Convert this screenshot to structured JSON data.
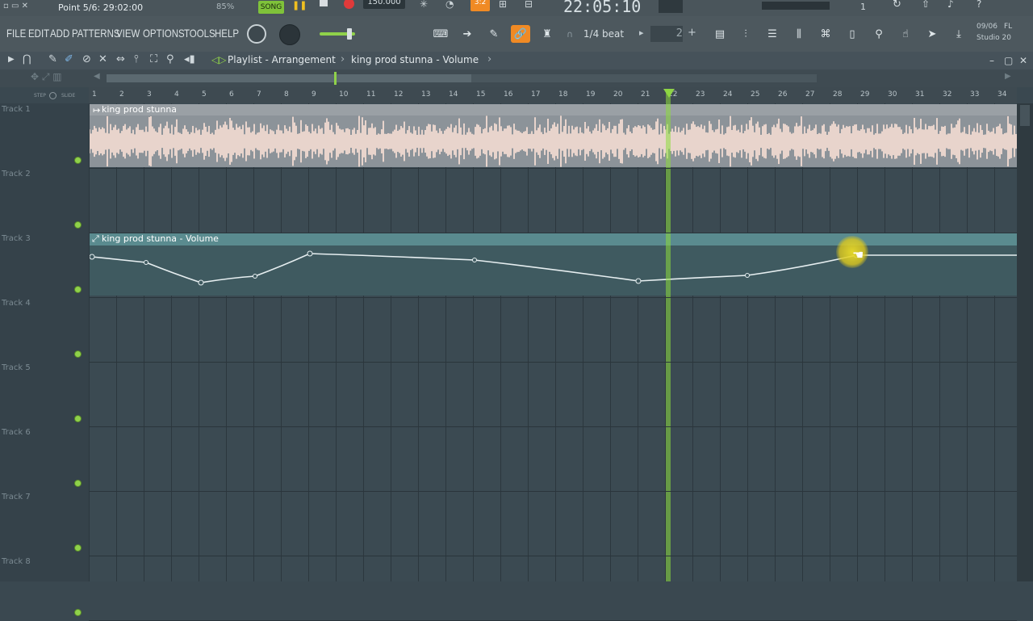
{
  "topbar": {
    "hint": "Point 5/6: 29:02:00",
    "cpu": "85%",
    "song_mode": "SONG",
    "tempo": "150.000",
    "clock": "22:05:10",
    "pattern": "1",
    "date": "09/06",
    "app_name": "FL",
    "app_sub": "Studio 20"
  },
  "menu": {
    "items": [
      "FILE",
      "EDIT",
      "ADD",
      "PATTERNS",
      "VIEW",
      "OPTIONS",
      "TOOLS",
      "HELP"
    ]
  },
  "toolbar": {
    "snap": "1/4 beat",
    "step_value": "2"
  },
  "playlist": {
    "breadcrumb_root": "Playlist - Arrangement",
    "breadcrumb_sep": "›",
    "breadcrumb_item": "king prod stunna - Volume",
    "step_label": "STEP",
    "slide_label": "SLIDE"
  },
  "ruler": {
    "bars": [
      "1",
      "2",
      "3",
      "4",
      "5",
      "6",
      "7",
      "8",
      "9",
      "10",
      "11",
      "12",
      "13",
      "14",
      "15",
      "16",
      "17",
      "18",
      "19",
      "20",
      "21",
      "22",
      "23",
      "24",
      "25",
      "26",
      "27",
      "28",
      "29",
      "30",
      "31",
      "32",
      "33",
      "34"
    ]
  },
  "tracks": [
    "Track 1",
    "Track 2",
    "Track 3",
    "Track 4",
    "Track 5",
    "Track 6",
    "Track 7",
    "Track 8"
  ],
  "clips": {
    "audio": {
      "name": "king prod stunna"
    },
    "automation": {
      "name": "king prod stunna - Volume"
    }
  },
  "colors": {
    "accent_green": "#8fd14a",
    "automation_header": "#5a8b8f",
    "audio_clip": "#e8d4cc",
    "highlight_orange": "#f08a24"
  }
}
